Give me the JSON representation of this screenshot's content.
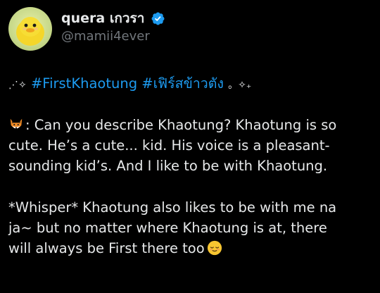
{
  "user": {
    "display_name": "quera เกวรา",
    "handle": "@mamii4ever"
  },
  "tweet": {
    "sparkle_prefix": "⋰✧",
    "hashtag1": "#FirstKhaotung",
    "hashtag2": "#เฟิร์สข้าวตัง",
    "sparkle_suffix": "。✧₊",
    "para1_line1": ": Can you describe Khaotung? Khaotung is so",
    "para1_line2": "cute. He’s a cute... kid. His voice is a pleasant-",
    "para1_line3": "sounding kid’s. And I like to be with Khaotung.",
    "para2_line1": "*Whisper* Khaotung also likes to be with me na",
    "para2_line2": "ja~ but no matter where Khaotung is at, there",
    "para2_line3": "will always be First there too",
    "fox_emoji": "fox-face-icon",
    "end_emoji": "relieved-face-icon"
  },
  "colors": {
    "background": "#000000",
    "text": "#e7e9ea",
    "muted": "#71767b",
    "link": "#1d9bf0",
    "verified": "#1d9bf0"
  }
}
